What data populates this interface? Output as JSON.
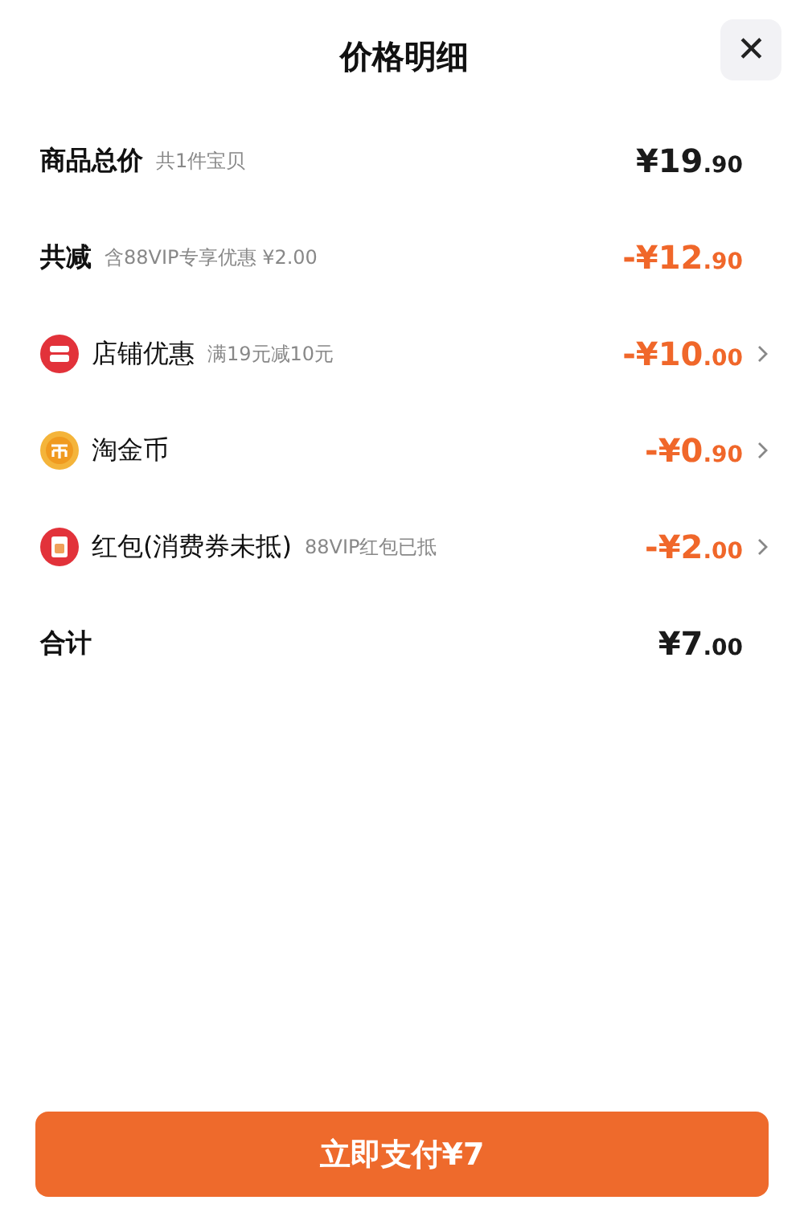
{
  "sheet": {
    "title": "价格明细",
    "close": "✕"
  },
  "rows": [
    {
      "kind": "total",
      "label": "商品总价",
      "note": "共1件宝贝",
      "price_main": "¥19",
      "price_cents": ".90",
      "chevron": false
    },
    {
      "kind": "discount",
      "label": "共减",
      "note": "含88VIP专享优惠 ¥2.00",
      "price_main": "-¥12",
      "price_cents": ".90",
      "chevron": false
    },
    {
      "kind": "item",
      "label": "店铺优惠",
      "note": "满19元减10元",
      "price_main": "-¥10",
      "price_cents": ".00",
      "chevron": true
    },
    {
      "kind": "item",
      "label": "淘金币",
      "price_main": "-¥0",
      "price_cents": ".90",
      "chevron": true
    },
    {
      "kind": "item",
      "label": "红包(消费券未抵)",
      "note": "88VIP红包已抵",
      "price_main": "-¥2",
      "price_cents": ".00",
      "chevron": true
    },
    {
      "kind": "total",
      "label": "合计",
      "price_main": "¥7",
      "price_cents": ".00",
      "chevron": false
    }
  ],
  "pay_button": "立即支付¥7"
}
